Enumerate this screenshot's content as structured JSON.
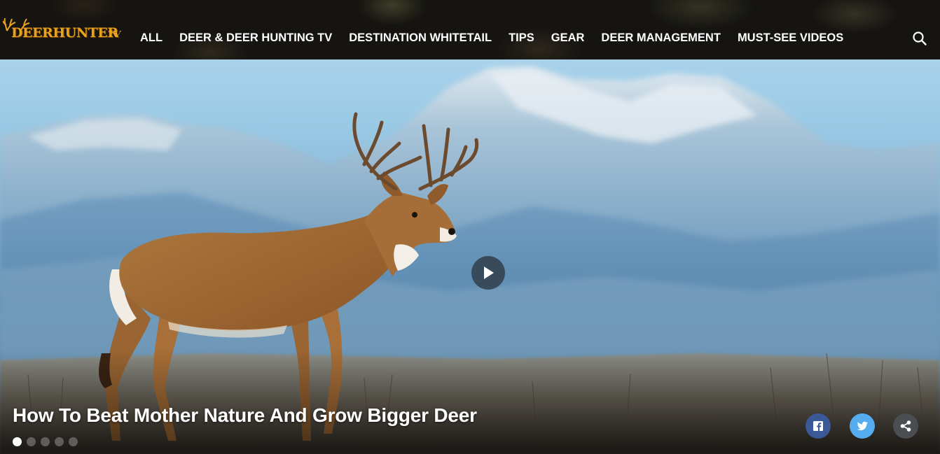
{
  "brand": {
    "logo_text": "DEERHUNTER",
    "logo_suffix": "TV",
    "accent_color": "#e8a21e"
  },
  "nav": {
    "items": [
      {
        "label": "ALL"
      },
      {
        "label": "DEER & DEER HUNTING TV"
      },
      {
        "label": "DESTINATION WHITETAIL"
      },
      {
        "label": "TIPS"
      },
      {
        "label": "GEAR"
      },
      {
        "label": "DEER MANAGEMENT"
      },
      {
        "label": "MUST-SEE VIDEOS"
      }
    ],
    "search_icon": "search-icon"
  },
  "hero": {
    "title": "How To Beat Mother Nature And Grow Bigger Deer",
    "play_icon": "play-icon",
    "slides_total": 5,
    "active_slide": 1
  },
  "share": {
    "facebook_icon": "facebook-icon",
    "twitter_icon": "twitter-icon",
    "share_icon": "share-icon",
    "facebook_color": "#3b5998",
    "twitter_color": "#55acee"
  }
}
